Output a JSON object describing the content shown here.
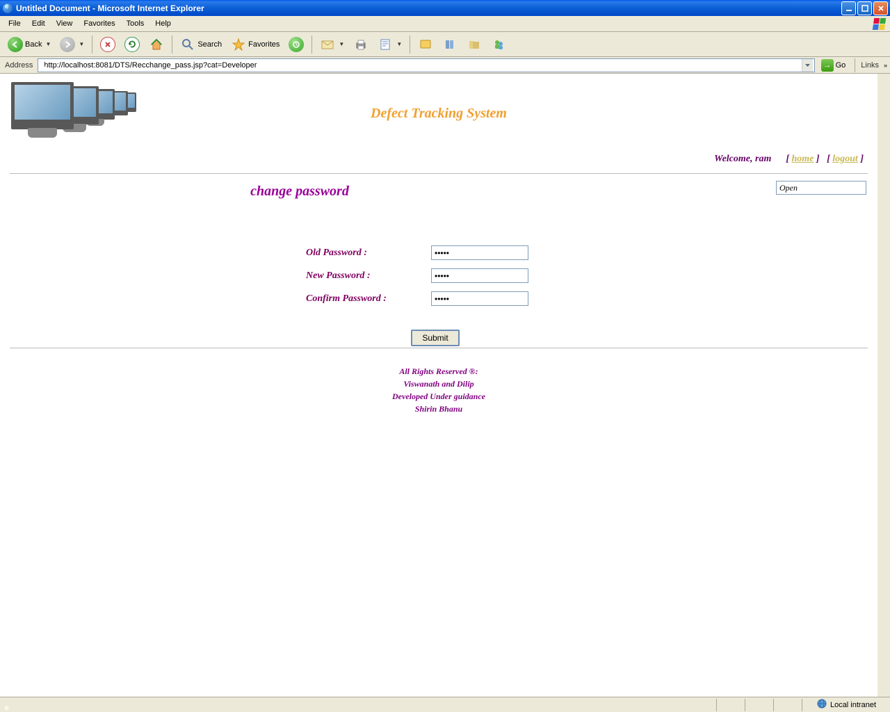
{
  "window": {
    "title": "Untitled Document - Microsoft Internet Explorer"
  },
  "menu": {
    "file": "File",
    "edit": "Edit",
    "view": "View",
    "favorites": "Favorites",
    "tools": "Tools",
    "help": "Help"
  },
  "toolbar": {
    "back": "Back",
    "search": "Search",
    "favorites": "Favorites"
  },
  "addressbar": {
    "label": "Address",
    "url": "http://localhost:8081/DTS/Recchange_pass.jsp?cat=Developer",
    "go": "Go",
    "links": "Links"
  },
  "page": {
    "app_title": "Defect Tracking System",
    "welcome_prefix": "Welcome,  ram",
    "home_link": "home",
    "logout_link": "logout",
    "open_value": "Open",
    "section_title": "change password",
    "form": {
      "old_label": "Old Password :",
      "old_value": "•••••",
      "new_label": "New Password :",
      "new_value": "•••••",
      "confirm_label": "Confirm Password :",
      "confirm_value": "•••••",
      "submit": "Submit"
    },
    "footer": {
      "line1": "All Rights Reserved ®:",
      "line2": "Viswanath and Dilip",
      "line3": "Developed Under guidance",
      "line4": "Shirin Bhanu"
    }
  },
  "statusbar": {
    "zone": "Local intranet"
  }
}
